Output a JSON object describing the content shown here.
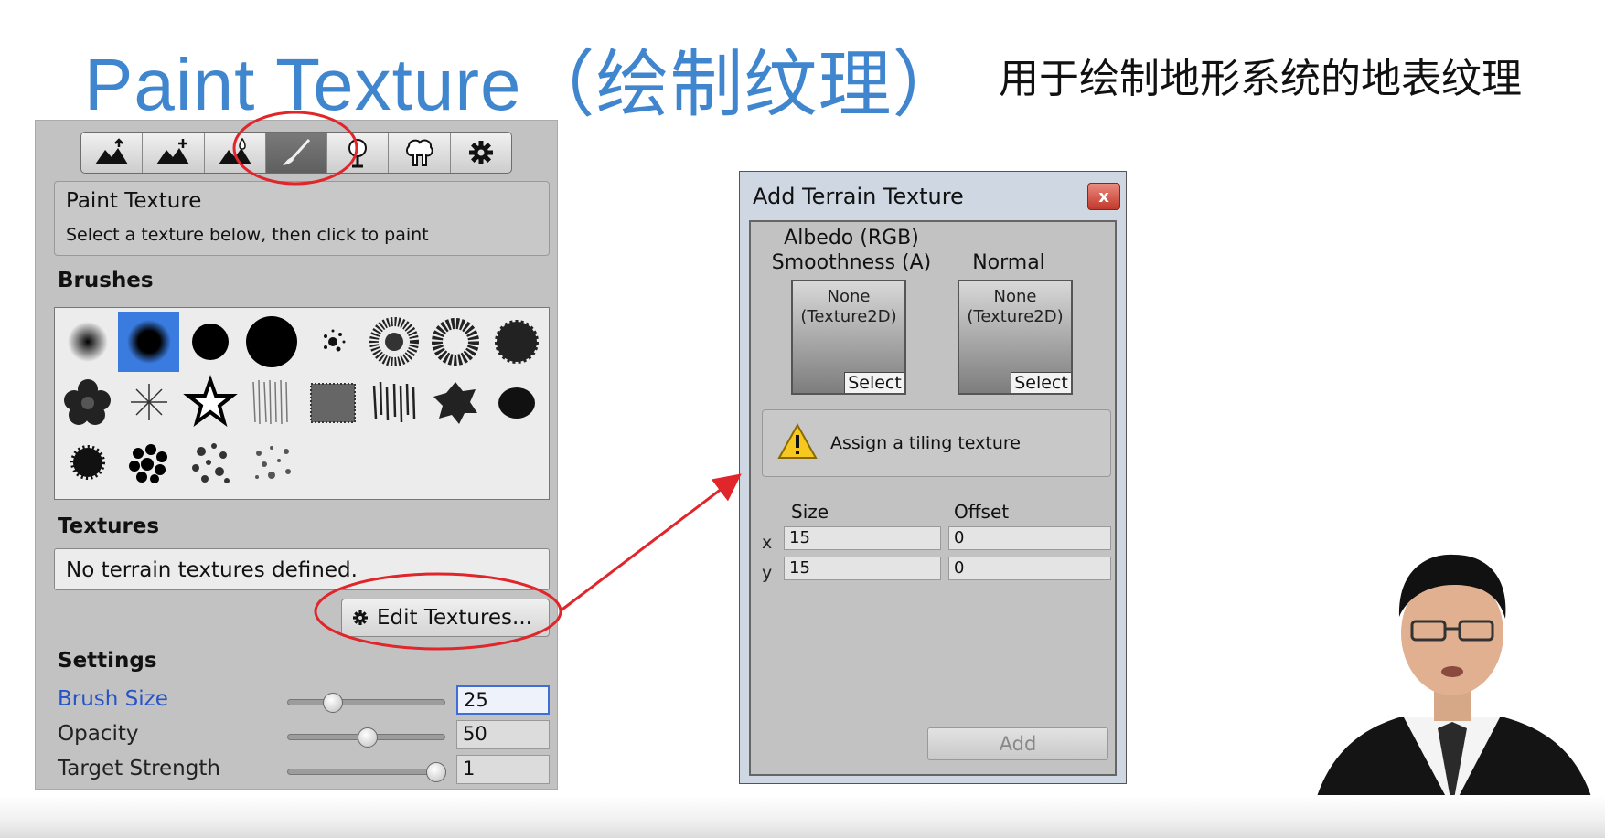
{
  "slide": {
    "title": "Paint Texture（绘制纹理）",
    "subtitle": "用于绘制地形系统的地表纹理"
  },
  "inspector": {
    "toolbar": [
      {
        "icon": "raise-terrain-icon",
        "active": false
      },
      {
        "icon": "paint-height-icon",
        "active": false
      },
      {
        "icon": "smooth-height-icon",
        "active": false
      },
      {
        "icon": "paint-brush-icon",
        "active": true
      },
      {
        "icon": "place-trees-icon",
        "active": false
      },
      {
        "icon": "paint-details-icon",
        "active": false
      },
      {
        "icon": "settings-gear-icon",
        "active": false
      }
    ],
    "help_title": "Paint Texture",
    "help_desc": "Select a texture below, then click to paint",
    "brushes_label": "Brushes",
    "textures_label": "Textures",
    "textures_empty": "No terrain textures defined.",
    "edit_textures_label": "Edit Textures...",
    "settings_label": "Settings",
    "settings": [
      {
        "label": "Brush Size",
        "value": "25",
        "slider_fraction": 0.25
      },
      {
        "label": "Opacity",
        "value": "50",
        "slider_fraction": 0.5
      },
      {
        "label": "Target Strength",
        "value": "1",
        "slider_fraction": 1.0
      }
    ]
  },
  "dialog": {
    "title": "Add Terrain Texture",
    "close_label": "x",
    "albedo_label_line1": "Albedo (RGB)",
    "albedo_label_line2": "Smoothness (A)",
    "normal_label": "Normal",
    "slot_none_line1": "None",
    "slot_none_line2": "(Texture2D)",
    "slot_select": "Select",
    "warning_text": "Assign a tiling texture",
    "size_label": "Size",
    "offset_label": "Offset",
    "x_label": "x",
    "y_label": "y",
    "size_x": "15",
    "size_y": "15",
    "offset_x": "0",
    "offset_y": "0",
    "add_label": "Add"
  },
  "colors": {
    "title_blue": "#3f86cf",
    "highlight_red": "#e0262a",
    "selected_brush": "#3a7be0"
  }
}
